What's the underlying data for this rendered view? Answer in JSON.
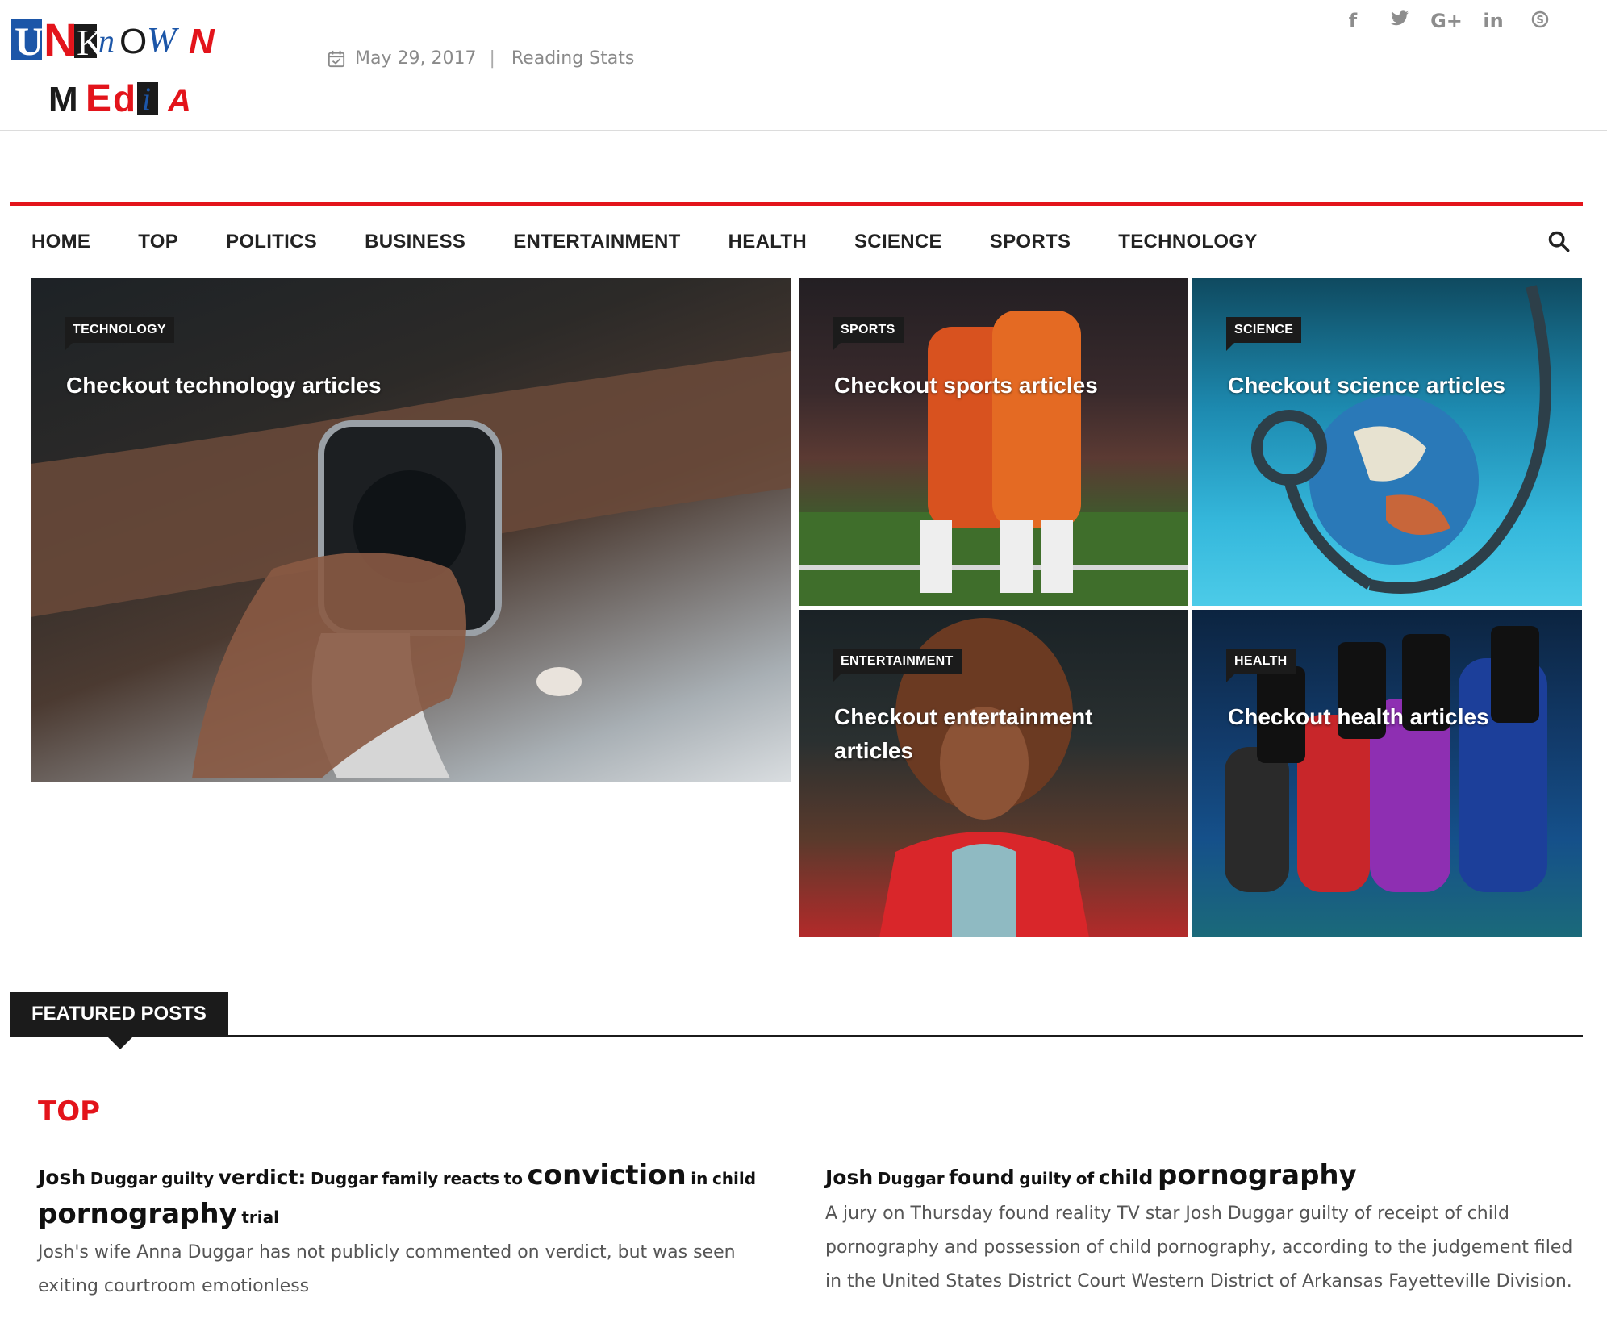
{
  "header": {
    "logo_text_top": "UNKNOWN",
    "logo_text_bottom": "MEdiA",
    "date": "May 29, 2017",
    "separator": "|",
    "reading_stats": "Reading Stats",
    "social_icons": [
      "facebook-icon",
      "twitter-icon",
      "google-plus-icon",
      "linkedin-icon",
      "skype-icon"
    ],
    "social_glyphs": [
      "f",
      "✦",
      "G+",
      "in",
      "S"
    ]
  },
  "nav": {
    "items": [
      "HOME",
      "TOP",
      "POLITICS",
      "BUSINESS",
      "ENTERTAINMENT",
      "HEALTH",
      "SCIENCE",
      "SPORTS",
      "TECHNOLOGY"
    ],
    "accent": "#e3141b"
  },
  "tiles": {
    "technology": {
      "badge": "TECHNOLOGY",
      "title": "Checkout technology articles"
    },
    "sports": {
      "badge": "SPORTS",
      "title": "Checkout sports articles"
    },
    "science": {
      "badge": "SCIENCE",
      "title": "Checkout science articles"
    },
    "entertainment": {
      "badge": "ENTERTAINMENT",
      "title": "Checkout entertainment articles"
    },
    "health": {
      "badge": "HEALTH",
      "title": "Checkout health articles"
    }
  },
  "featured": {
    "heading": "FEATURED POSTS",
    "section": "TOP",
    "posts": [
      {
        "headline_words": [
          "Josh",
          "Duggar",
          "guilty",
          "verdict:",
          "Duggar",
          "family",
          "reacts",
          "to",
          "conviction",
          "in",
          "child",
          "pornography",
          "trial"
        ],
        "excerpt": "Josh's wife Anna Duggar has not publicly commented on verdict, but was seen exiting courtroom emotionless"
      },
      {
        "headline_words": [
          "Josh",
          "Duggar",
          "found",
          "guilty",
          "of",
          "child",
          "pornography"
        ],
        "excerpt": "A jury on Thursday found reality TV star Josh Duggar guilty of receipt of child pornography and possession of child pornography, according to the judgement filed in the United States District Court Western District of Arkansas Fayetteville Division."
      }
    ]
  }
}
